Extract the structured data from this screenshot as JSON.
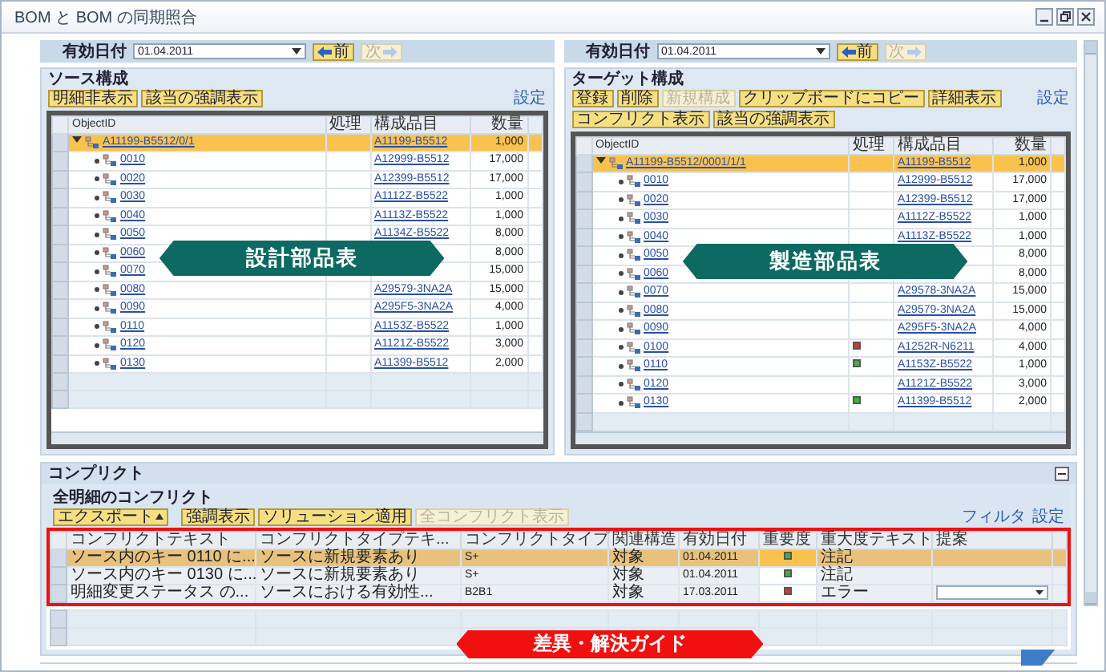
{
  "window": {
    "title": "BOM と BOM の同期照合"
  },
  "source": {
    "date_label": "有効日付",
    "date": "01.04.2011",
    "prev_button": {
      "label": "前",
      "disabled": false
    },
    "next_button": {
      "label": "次",
      "disabled": true
    },
    "title": "ソース構成",
    "toolbar": [
      {
        "label": "明細非表示",
        "disabled": false
      },
      {
        "label": "該当の強調表示",
        "disabled": false
      }
    ],
    "settings_link": "設定",
    "columns": [
      "ObjectID",
      "処理",
      "構成品目",
      "数量"
    ],
    "banner": "設計部品表",
    "tree": [
      {
        "id": "A11199-B5512/0/1",
        "component": "A11199-B5512",
        "quantity": "1,000",
        "expanded": true,
        "selected": true,
        "children": [
          {
            "id": "0010",
            "component": "A12999-B5512",
            "quantity": "17,000",
            "selected": false
          },
          {
            "id": "0020",
            "component": "A12399-B5512",
            "quantity": "17,000",
            "selected": false
          },
          {
            "id": "0030",
            "component": "A1112Z-B5522",
            "quantity": "1,000",
            "selected": false
          },
          {
            "id": "0040",
            "component": "A1113Z-B5522",
            "quantity": "1,000",
            "selected": false
          },
          {
            "id": "0050",
            "component": "A1134Z-B5522",
            "quantity": "8,000",
            "selected": false
          },
          {
            "id": "0060",
            "quantity": "8,000",
            "selected": false
          },
          {
            "id": "0070",
            "quantity": "15,000",
            "selected": false
          },
          {
            "id": "0080",
            "component": "A29579-3NA2A",
            "quantity": "15,000",
            "selected": false
          },
          {
            "id": "0090",
            "component": "A295F5-3NA2A",
            "quantity": "4,000",
            "selected": false
          },
          {
            "id": "0110",
            "component": "A1153Z-B5522",
            "quantity": "1,000",
            "selected": false
          },
          {
            "id": "0120",
            "component": "A1121Z-B5522",
            "quantity": "3,000",
            "selected": false
          },
          {
            "id": "0130",
            "component": "A11399-B5512",
            "quantity": "2,000",
            "selected": false
          }
        ]
      }
    ]
  },
  "target": {
    "date_label": "有効日付",
    "date": "01.04.2011",
    "prev_button": {
      "label": "前",
      "disabled": false
    },
    "next_button": {
      "label": "次",
      "disabled": true
    },
    "title": "ターゲット構成",
    "toolbar": [
      {
        "label": "登録",
        "disabled": false
      },
      {
        "label": "削除",
        "disabled": false
      },
      {
        "label": "新規構成",
        "disabled": true
      },
      {
        "label": "クリップボードにコピー",
        "disabled": false
      },
      {
        "label": "詳細表示",
        "disabled": false
      },
      {
        "label": "コンフリクト表示",
        "disabled": false
      },
      {
        "label": "該当の強調表示",
        "disabled": false
      }
    ],
    "settings_link": "設定",
    "columns": [
      "ObjectID",
      "処理",
      "構成品目",
      "数量"
    ],
    "banner": "製造部品表",
    "tree": [
      {
        "id": "A11199-B5512/0001/1/1",
        "component": "A11199-B5512",
        "quantity": "1,000",
        "expanded": true,
        "selected": true,
        "children": [
          {
            "id": "0010",
            "component": "A12999-B5512",
            "quantity": "17,000",
            "selected": false
          },
          {
            "id": "0020",
            "component": "A12399-B5512",
            "quantity": "17,000",
            "selected": false
          },
          {
            "id": "0030",
            "component": "A1112Z-B5522",
            "quantity": "1,000",
            "selected": false
          },
          {
            "id": "0040",
            "component": "A1113Z-B5522",
            "quantity": "1,000",
            "selected": false
          },
          {
            "id": "0050",
            "quantity": "8,000",
            "selected": false
          },
          {
            "id": "0060",
            "quantity": "8,000",
            "selected": false
          },
          {
            "id": "0070",
            "component": "A29578-3NA2A",
            "quantity": "15,000",
            "selected": false
          },
          {
            "id": "0080",
            "component": "A29579-3NA2A",
            "quantity": "15,000",
            "selected": false
          },
          {
            "id": "0090",
            "component": "A295F5-3NA2A",
            "quantity": "4,000",
            "selected": false
          },
          {
            "id": "0100",
            "color": "#d9362b",
            "component": "A1252R-N6211",
            "quantity": "4,000",
            "selected": false
          },
          {
            "id": "0110",
            "color": "#3db33a",
            "component": "A1153Z-B5522",
            "quantity": "1,000",
            "selected": false
          },
          {
            "id": "0120",
            "component": "A1121Z-B5522",
            "quantity": "3,000",
            "selected": false
          },
          {
            "id": "0130",
            "color": "#3db33a",
            "component": "A11399-B5512",
            "quantity": "2,000",
            "selected": false
          }
        ]
      }
    ]
  },
  "conflicts": {
    "title": "コンプリクト",
    "subtitle": "全明細のコンフリクト",
    "toolbar": [
      {
        "label": "エクスポート",
        "kind": "menu",
        "disabled": false
      },
      {
        "label": "強調表示",
        "kind": "button",
        "disabled": false
      },
      {
        "label": "ソリューション適用",
        "kind": "button",
        "disabled": false
      },
      {
        "label": "全コンフリクト表示",
        "kind": "button",
        "disabled": true
      }
    ],
    "filter_link": "フィルタ",
    "settings_link": "設定",
    "columns": [
      "コンフリクトテキスト",
      "コンフリクトタイプテキ...",
      "コンフリクトタイプ",
      "関連構造",
      "有効日付",
      "重要度",
      "重大度テキスト",
      "提案"
    ],
    "rows": [
      {
        "text": "ソース内のキー 0110 に...",
        "type_text": "ソースに新規要素あり",
        "type": "S+",
        "related": "対象",
        "date": "01.04.2011",
        "color": "#3db33a",
        "severity_text": "注記",
        "proposal_dropdown": false,
        "selected": true
      },
      {
        "text": "ソース内のキー 0130 に...",
        "type_text": "ソースに新規要素あり",
        "type": "S+",
        "related": "対象",
        "date": "01.04.2011",
        "color": "#3db33a",
        "severity_text": "注記",
        "proposal_dropdown": false,
        "selected": false
      },
      {
        "text": "明細変更ステータス の...",
        "type_text": "ソースにおける有効性...",
        "type": "B2B1",
        "related": "対象",
        "date": "17.03.2011",
        "color": "#d9362b",
        "severity_text": "エラー",
        "proposal_dropdown": true,
        "selected": false
      }
    ],
    "banner": "差異・解決ガイド"
  }
}
